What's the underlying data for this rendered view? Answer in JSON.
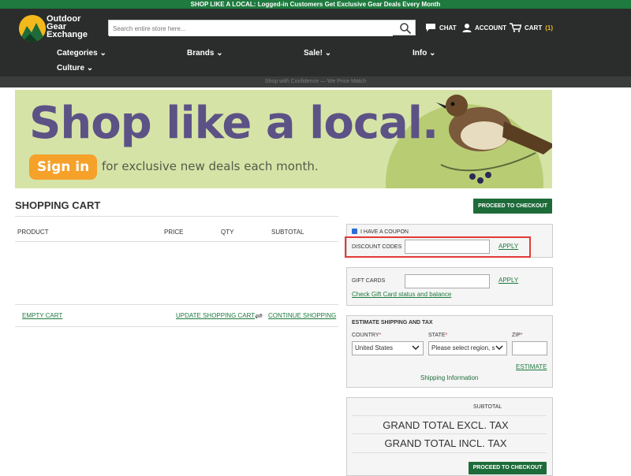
{
  "promo_bar": "SHOP LIKE A LOCAL: Logged-in Customers Get Exclusive Gear Deals Every Month",
  "logo": {
    "line1": "Outdoor",
    "line2": "Gear",
    "line3": "Exchange"
  },
  "search": {
    "placeholder": "Search entire store here..."
  },
  "header_links": {
    "chat": "CHAT",
    "account": "ACCOUNT",
    "cart": "CART",
    "cart_count": "(1)"
  },
  "nav": {
    "categories": "Categories",
    "brands": "Brands",
    "sale": "Sale!",
    "info": "Info",
    "culture": "Culture"
  },
  "subbar": "Shop with Confidence — We Price Match",
  "banner": {
    "title": "Shop like a local.",
    "signin": "Sign in",
    "subtitle": "for exclusive new deals each month."
  },
  "cart": {
    "title": "SHOPPING CART",
    "proceed_top": "PROCEED TO CHECKOUT",
    "columns": {
      "product": "PRODUCT",
      "price": "PRICE",
      "qty": "QTY",
      "subtotal": "SUBTOTAL"
    },
    "empty_cart": "EMPTY CART",
    "update_cart": "UPDATE SHOPPING CART",
    "continue_shopping": "CONTINUE SHOPPING"
  },
  "coupon": {
    "checkbox_label": "I HAVE A COUPON",
    "checked": true,
    "discount_label": "DISCOUNT CODES",
    "discount_value": "",
    "apply": "APPLY"
  },
  "gift": {
    "label": "GIFT CARDS",
    "value": "",
    "apply": "APPLY",
    "check_link": "Check Gift Card status and balance"
  },
  "shipping": {
    "title": "ESTIMATE SHIPPING AND TAX",
    "country_label": "COUNTRY",
    "country_value": "United States",
    "state_label": "STATE",
    "state_value": "Please select region, s",
    "zip_label": "ZIP",
    "zip_value": "",
    "required_mark": "*",
    "estimate": "ESTIMATE",
    "info": "Shipping Information"
  },
  "totals": {
    "subtotal_label": "SUBTOTAL",
    "excl": "GRAND TOTAL EXCL. TAX",
    "incl": "GRAND TOTAL INCL. TAX",
    "proceed_bottom": "PROCEED TO CHECKOUT"
  },
  "colors": {
    "brand_green": "#1e6b3a",
    "header_dark": "#2a2d2c",
    "accent_yellow": "#f2b81c",
    "highlight_red": "#e23a36"
  }
}
